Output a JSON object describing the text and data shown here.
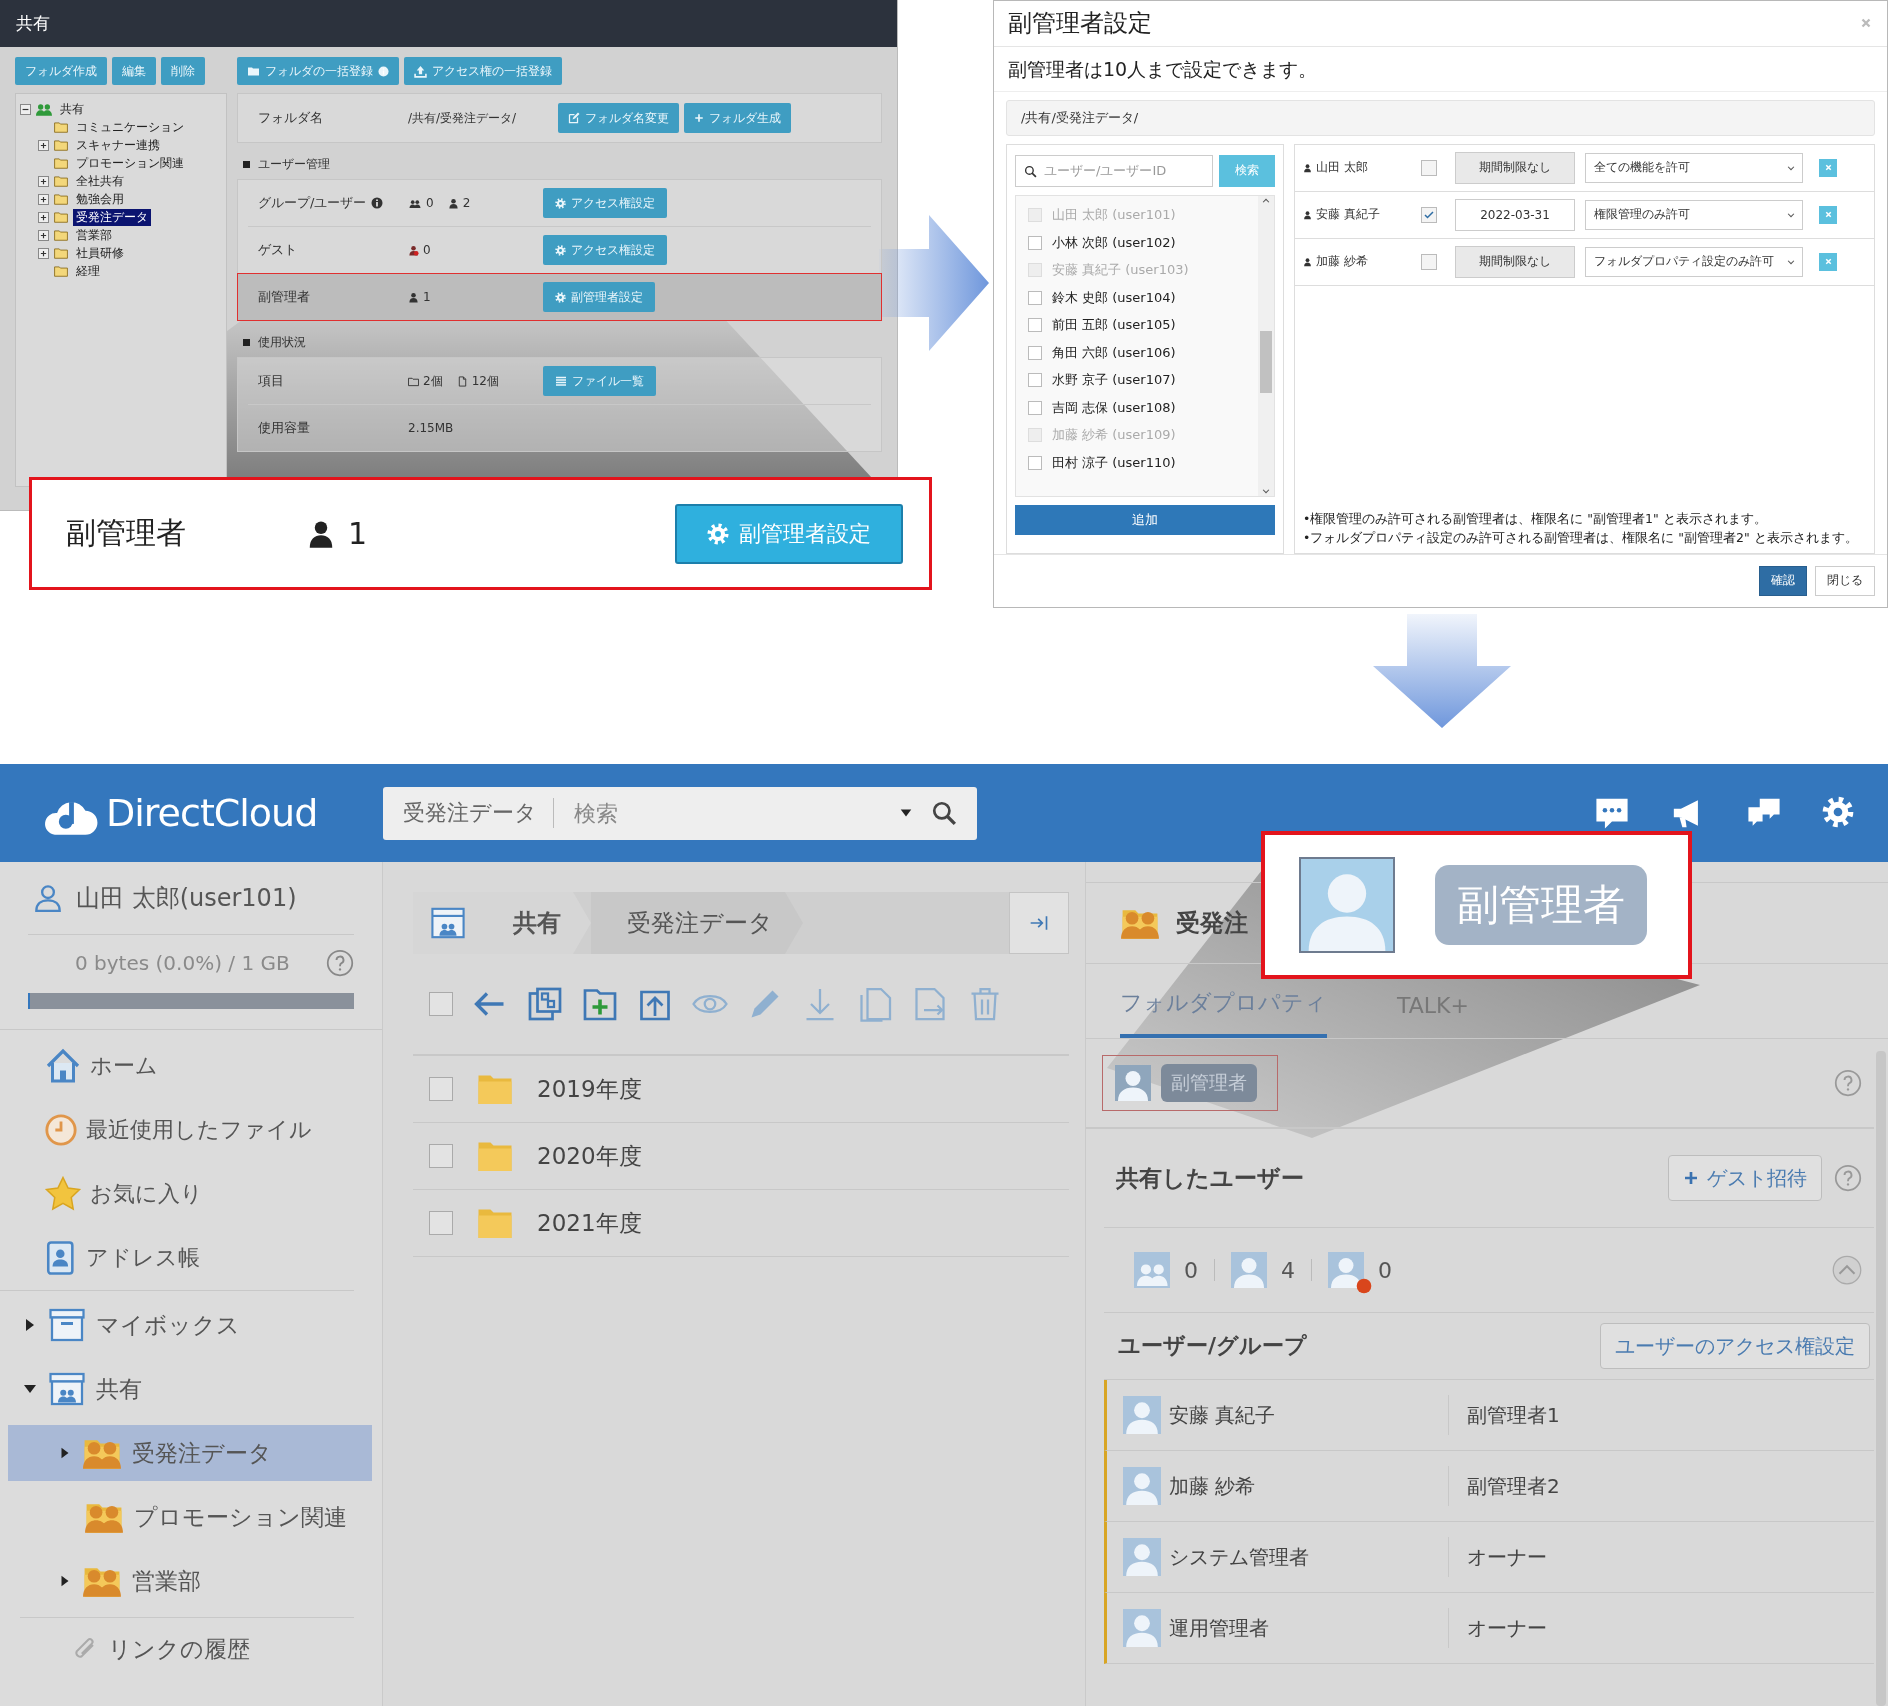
{
  "admin_panel": {
    "title": "共有",
    "tree_buttons": [
      "フォルダ作成",
      "編集",
      "削除"
    ],
    "bulk_buttons": [
      {
        "label": "フォルダの一括登録",
        "kind": "folder",
        "info": true
      },
      {
        "label": "アクセス権の一括登録",
        "kind": "upload",
        "info": false
      }
    ],
    "tree": {
      "label": "共有",
      "expanded": true,
      "children": [
        {
          "label": "コミュニケーション",
          "expandable": false,
          "selected": false
        },
        {
          "label": "スキャナー連携",
          "expandable": true,
          "selected": false
        },
        {
          "label": "プロモーション関連",
          "expandable": false,
          "selected": false
        },
        {
          "label": "全社共有",
          "expandable": true,
          "selected": false
        },
        {
          "label": "勉強会用",
          "expandable": true,
          "selected": false
        },
        {
          "label": "受発注データ",
          "expandable": true,
          "selected": true
        },
        {
          "label": "営業部",
          "expandable": true,
          "selected": false
        },
        {
          "label": "社員研修",
          "expandable": true,
          "selected": false
        },
        {
          "label": "経理",
          "expandable": false,
          "selected": false
        }
      ]
    },
    "folder_row": {
      "label": "フォルダ名",
      "path": "/共有/受発注データ/",
      "buttons": [
        {
          "label": "フォルダ名変更",
          "kind": "edit"
        },
        {
          "label": "フォルダ生成",
          "kind": "plus"
        }
      ]
    },
    "user_section": {
      "heading": "ユーザー管理",
      "rows": [
        {
          "label": "グループ/ユーザー",
          "info": true,
          "highlighted": false,
          "counts": [
            {
              "kind": "group",
              "value": "0"
            },
            {
              "kind": "user",
              "value": "2"
            }
          ],
          "button": "アクセス権設定"
        },
        {
          "label": "ゲスト",
          "info": false,
          "highlighted": false,
          "counts": [
            {
              "kind": "guest",
              "value": "0"
            }
          ],
          "button": "アクセス権設定"
        },
        {
          "label": "副管理者",
          "info": false,
          "highlighted": true,
          "counts": [
            {
              "kind": "user",
              "value": "1"
            }
          ],
          "button": "副管理者設定"
        }
      ]
    },
    "usage_section": {
      "heading": "使用状況",
      "rows": [
        {
          "label": "項目",
          "counts": [
            {
              "kind": "folder",
              "value": "2個"
            },
            {
              "kind": "file",
              "value": "12個"
            }
          ],
          "button": "ファイル一覧"
        },
        {
          "label": "使用容量",
          "value": "2.15MB"
        }
      ]
    },
    "zoom": {
      "label": "副管理者",
      "count": "1",
      "button": "副管理者設定"
    }
  },
  "dialog": {
    "title": "副管理者設定",
    "note": "副管理者は10人まで設定できます。",
    "path": "/共有/受発注データ/",
    "search": {
      "placeholder": "ユーザー/ユーザーID",
      "button": "検索"
    },
    "candidates": [
      {
        "label": "山田 太郎 (user101)",
        "disabled": true
      },
      {
        "label": "小林 次郎 (user102)",
        "disabled": false
      },
      {
        "label": "安藤 真紀子 (user103)",
        "disabled": true
      },
      {
        "label": "鈴木 史郎 (user104)",
        "disabled": false
      },
      {
        "label": "前田 五郎 (user105)",
        "disabled": false
      },
      {
        "label": "角田 六郎 (user106)",
        "disabled": false
      },
      {
        "label": "水野 京子 (user107)",
        "disabled": false
      },
      {
        "label": "吉岡 志保 (user108)",
        "disabled": false
      },
      {
        "label": "加藤 紗希 (user109)",
        "disabled": true
      },
      {
        "label": "田村 涼子 (user110)",
        "disabled": false
      }
    ],
    "add_button": "追加",
    "assigned": [
      {
        "name": "山田 太郎",
        "checked": false,
        "period": "期間制限なし",
        "permission": "全ての機能を許可"
      },
      {
        "name": "安藤 真紀子",
        "checked": true,
        "period": "2022-03-31",
        "permission": "権限管理のみ許可"
      },
      {
        "name": "加藤 紗希",
        "checked": false,
        "period": "期間制限なし",
        "permission": "フォルダプロパティ設定のみ許可"
      }
    ],
    "footnotes": [
      "•権限管理のみ許可される副管理者は、権限名に \"副管理者1\" と表示されます。",
      "•フォルダプロパティ設定のみ許可される副管理者は、権限名に \"副管理者2\" と表示されます。"
    ],
    "buttons": [
      {
        "label": "確認",
        "kind": "primary"
      },
      {
        "label": "閉じる",
        "kind": "default"
      }
    ]
  },
  "app": {
    "logo": "DirectCloud",
    "search": {
      "scope": "受発注データ",
      "placeholder": "検索"
    },
    "user": "山田 太郎(user101)",
    "storage": "0 bytes (0.0%) / 1 GB",
    "storage_bar": {
      "level": 0
    },
    "nav": [
      {
        "label": "ホーム",
        "kind": "home"
      },
      {
        "label": "最近使用したファイル",
        "kind": "clock"
      },
      {
        "label": "お気に入り",
        "kind": "star"
      },
      {
        "label": "アドレス帳",
        "kind": "contacts"
      }
    ],
    "tree": [
      {
        "label": "マイボックス",
        "kind": "box",
        "expanded": false
      },
      {
        "label": "共有",
        "kind": "shared",
        "expanded": true,
        "children": [
          {
            "label": "受発注データ",
            "selected": true,
            "has_children": true
          },
          {
            "label": "プロモーション関連",
            "selected": false,
            "has_children": false
          },
          {
            "label": "営業部",
            "selected": false,
            "has_children": true
          }
        ]
      }
    ],
    "history": "リンクの履歴",
    "breadcrumb": [
      "共有",
      "受発注データ"
    ],
    "select_all": {
      "checked": false
    },
    "files": [
      {
        "name": "2019年度",
        "checked": false
      },
      {
        "name": "2020年度",
        "checked": false
      },
      {
        "name": "2021年度",
        "checked": false
      }
    ],
    "folder_title": "受発注",
    "tabs": [
      {
        "label": "フォルダプロパティ",
        "selected": true
      },
      {
        "label": "TALK+",
        "selected": false
      }
    ],
    "role_badge": "副管理者",
    "shared_heading": "共有したユーザー",
    "guest_button": "ゲスト招待",
    "counts": [
      {
        "kind": "group",
        "value": "0"
      },
      {
        "kind": "user",
        "value": "4"
      },
      {
        "kind": "guest",
        "value": "0"
      }
    ],
    "table_heading": "ユーザー/グループ",
    "access_button": "ユーザーのアクセス権設定",
    "members": [
      {
        "name": "安藤 真紀子",
        "role": "副管理者1"
      },
      {
        "name": "加藤 紗希",
        "role": "副管理者2"
      },
      {
        "name": "システム管理者",
        "role": "オーナー"
      },
      {
        "name": "運用管理者",
        "role": "オーナー"
      }
    ],
    "callout": {
      "label": "副管理者"
    }
  }
}
